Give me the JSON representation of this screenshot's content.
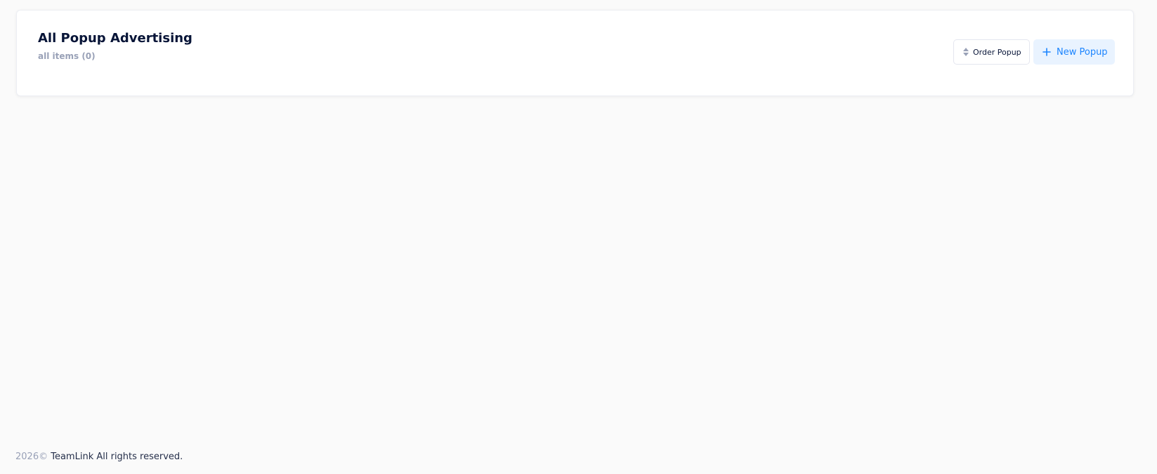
{
  "header": {
    "title": "All Popup Advertising",
    "subtitle": "all items (0)"
  },
  "toolbar": {
    "order_label": "Order Popup",
    "order_icon": "sort-icon",
    "new_label": "New Popup",
    "new_icon": "plus-icon"
  },
  "footer": {
    "year": "2026©",
    "text": "TeamLink All rights reserved."
  },
  "colors": {
    "page_background": "#fafafa",
    "card_background": "#ffffff",
    "title": "#071437",
    "muted": "#99a1b7",
    "accent": "#1b84ff",
    "accent_light": "#e9f3ff"
  }
}
